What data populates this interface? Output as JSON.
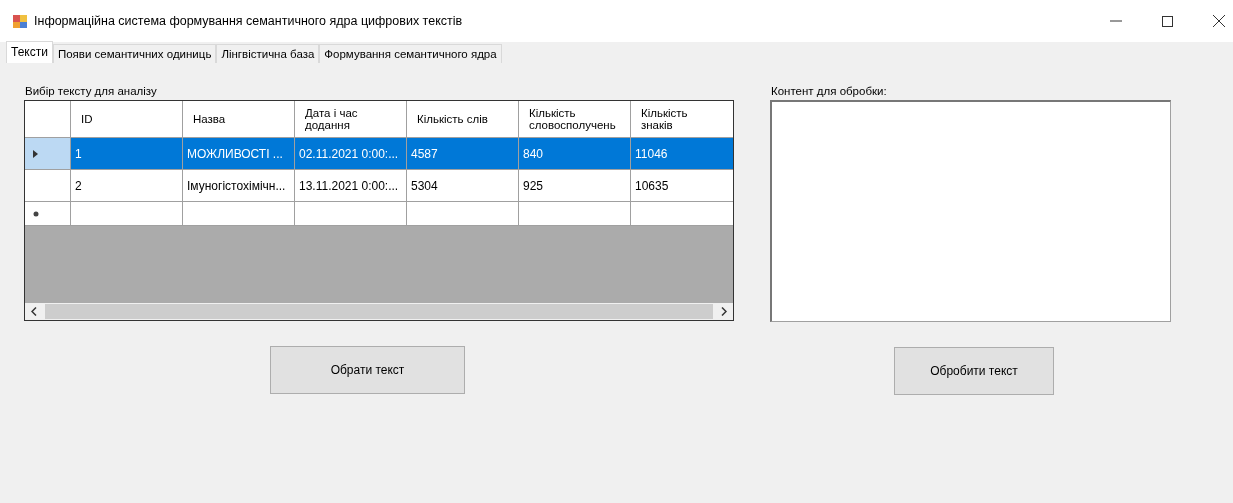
{
  "window": {
    "title": "Інформаційна система формування семантичного ядра цифрових текстів"
  },
  "tabs": [
    {
      "label": "Тексти",
      "selected": true
    },
    {
      "label": "Появи семантичних одиниць",
      "selected": false
    },
    {
      "label": "Лінгвістична база",
      "selected": false
    },
    {
      "label": "Формування семантичного ядра",
      "selected": false
    }
  ],
  "text_selection": {
    "label": "Вибір тексту для аналізу",
    "table": {
      "columns": [
        "ID",
        "Назва",
        "Дата і час додання",
        "Кількість слів",
        "Кількість словосполучень",
        "Кількість знаків"
      ],
      "rows": [
        {
          "selected": true,
          "cells": [
            "1",
            "МОЖЛИВОСТІ ...",
            "02.11.2021 0:00:...",
            "4587",
            "840",
            "11046"
          ]
        },
        {
          "selected": false,
          "cells": [
            "2",
            "Імуногістохімічн...",
            "13.11.2021 0:00:...",
            "5304",
            "925",
            "10635"
          ]
        }
      ]
    },
    "button": "Обрати текст"
  },
  "content": {
    "label": "Контент для обробки:",
    "button": "Обробити текст"
  }
}
